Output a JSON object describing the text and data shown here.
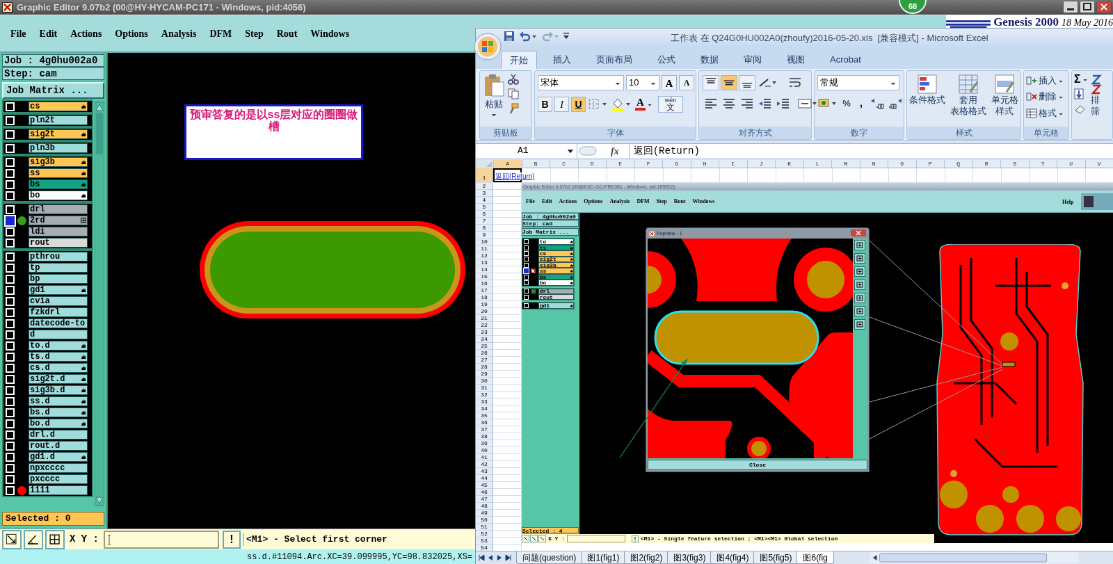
{
  "genesis": {
    "title": "Graphic Editor 9.07b2 (00@HY-HYCAM-PC171 - Windows, pid:4056)",
    "badge": "68",
    "logo_title": "Genesis 2000",
    "logo_date": "18 May 2016",
    "menu": [
      "File",
      "Edit",
      "Actions",
      "Options",
      "Analysis",
      "DFM",
      "Step",
      "Rout",
      "Windows"
    ],
    "job": "Job : 4g0hu002a0",
    "step": "Step: cam",
    "job_matrix": "Job Matrix ...",
    "layer_groups": [
      [
        {
          "name": "cs",
          "color": "#ffc655",
          "kind": "hand",
          "selected": false
        }
      ],
      [
        {
          "name": "pln2t",
          "color": "#a0dcdc",
          "kind": "plain",
          "selected": false
        }
      ],
      [
        {
          "name": "sig2t",
          "color": "#ffc655",
          "kind": "hand",
          "selected": false
        }
      ],
      [
        {
          "name": "pln3b",
          "color": "#a0dcdc",
          "kind": "plain",
          "selected": false
        }
      ],
      [
        {
          "name": "sig3b",
          "color": "#ffc655",
          "kind": "hand",
          "selected": false
        },
        {
          "name": "ss",
          "color": "#ffc655",
          "kind": "hand",
          "selected": false
        },
        {
          "name": "bs",
          "color": "#13a383",
          "kind": "hand",
          "selected": false
        },
        {
          "name": "bo",
          "color": "#ffffff",
          "kind": "hand",
          "selected": false
        }
      ],
      [
        {
          "name": "drl",
          "color": "#a6aeb4",
          "kind": "plain",
          "selected": false
        },
        {
          "name": "2rd",
          "color": "#a6aeb4",
          "kind": "grid",
          "dot": {
            "color": "#3a9a1a"
          },
          "selected": true
        },
        {
          "name": "ldi",
          "color": "#a6aeb4",
          "kind": "plain",
          "selected": false
        },
        {
          "name": "rout",
          "color": "#dadada",
          "kind": "plain",
          "selected": false
        }
      ],
      [
        {
          "name": "pthrou",
          "color": "#a0dcdc",
          "kind": "plain",
          "selected": false
        },
        {
          "name": "tp",
          "color": "#a0dcdc",
          "kind": "plain",
          "selected": false
        },
        {
          "name": "bp",
          "color": "#a0dcdc",
          "kind": "plain",
          "selected": false
        },
        {
          "name": "gd1",
          "color": "#a0dcdc",
          "kind": "hand",
          "selected": false
        },
        {
          "name": "cvia",
          "color": "#a0dcdc",
          "kind": "plain",
          "selected": false
        },
        {
          "name": "fzkdrl",
          "color": "#a0dcdc",
          "kind": "plain",
          "selected": false
        },
        {
          "name": "datecode-to",
          "color": "#a0dcdc",
          "kind": "plain",
          "selected": false
        },
        {
          "name": "d",
          "color": "#a0dcdc",
          "kind": "plain",
          "selected": false
        },
        {
          "name": "to.d",
          "color": "#a0dcdc",
          "kind": "hand",
          "selected": false
        },
        {
          "name": "ts.d",
          "color": "#a0dcdc",
          "kind": "hand",
          "selected": false
        },
        {
          "name": "cs.d",
          "color": "#a0dcdc",
          "kind": "hand",
          "selected": false
        },
        {
          "name": "sig2t.d",
          "color": "#a0dcdc",
          "kind": "hand",
          "selected": false
        },
        {
          "name": "sig3b.d",
          "color": "#a0dcdc",
          "kind": "hand",
          "selected": false
        },
        {
          "name": "ss.d",
          "color": "#a0dcdc",
          "kind": "hand",
          "selected": false
        },
        {
          "name": "bs.d",
          "color": "#a0dcdc",
          "kind": "hand",
          "selected": false
        },
        {
          "name": "bo.d",
          "color": "#a0dcdc",
          "kind": "hand",
          "selected": false
        },
        {
          "name": "drl.d",
          "color": "#a0dcdc",
          "kind": "plain",
          "selected": false
        },
        {
          "name": "rout.d",
          "color": "#a0dcdc",
          "kind": "plain",
          "selected": false
        },
        {
          "name": "gd1.d",
          "color": "#a0dcdc",
          "kind": "hand",
          "selected": false
        },
        {
          "name": "npxcccc",
          "color": "#a0dcdc",
          "kind": "plain",
          "selected": false
        },
        {
          "name": "pxcccc",
          "color": "#a0dcdc",
          "kind": "plain",
          "selected": false
        },
        {
          "name": "1111",
          "color": "#a0dcdc",
          "kind": "plain",
          "dot": {
            "color": "#ff0000"
          },
          "selected": false
        }
      ]
    ],
    "selected_count": "Selected : 0",
    "note": "预审答复的是以ss层对应的圈圈做槽",
    "xy_label": "X Y :",
    "alert_button": "!",
    "prompt": "<M1> - Select first corner",
    "status": "ss.d.#11094.Arc.XC=39.099995,YC=98.832025,XS="
  },
  "excel": {
    "title": "工作表 在 Q24G0HU002A0(zhoufy)2016-05-20.xls  [兼容模式] - Microsoft Excel",
    "tabs": [
      {
        "label": "开始",
        "selected": true
      },
      {
        "label": "插入",
        "selected": false
      },
      {
        "label": "页面布局",
        "selected": false
      },
      {
        "label": "公式",
        "selected": false
      },
      {
        "label": "数据",
        "selected": false
      },
      {
        "label": "审阅",
        "selected": false
      },
      {
        "label": "视图",
        "selected": false
      },
      {
        "label": "Acrobat",
        "selected": false
      }
    ],
    "ribbon": {
      "clipboard": {
        "paste": "粘贴",
        "label": "剪贴板"
      },
      "font": {
        "font_name": "宋体",
        "font_size": "10",
        "grow": "A",
        "shrink": "A",
        "format_buttons": [
          {
            "label": "B",
            "on": false
          },
          {
            "label": "I",
            "on": false
          },
          {
            "label": "U",
            "on": true
          }
        ],
        "font_color": "A",
        "phonetic_top": "wén",
        "phonetic_bottom": "文",
        "label": "字体"
      },
      "alignment": {
        "vertical": [
          {
            "on": false
          },
          {
            "on": true
          },
          {
            "on": false
          }
        ],
        "label": "对齐方式"
      },
      "number": {
        "format": "常规",
        "percent": "%",
        "comma": ",",
        "label": "数字"
      },
      "styles": {
        "items": [
          {
            "lines": [
              "条件格式"
            ]
          },
          {
            "lines": [
              "套用",
              "表格格式"
            ]
          },
          {
            "lines": [
              "单元格",
              "样式"
            ]
          }
        ],
        "label": "样式"
      },
      "cells": {
        "items": [
          "插入",
          "删除",
          "格式"
        ],
        "label": "单元格"
      },
      "editing": {
        "sum": "Σ",
        "sort_cut": "排",
        "filter_cut": "筛"
      }
    },
    "name_box": "A1",
    "fx": "fx",
    "formula": "返回(Return)",
    "columns": [
      "A",
      "B",
      "C",
      "D",
      "E",
      "F",
      "G",
      "H",
      "I",
      "J",
      "K",
      "L",
      "M",
      "N",
      "O",
      "P",
      "Q",
      "R",
      "S",
      "T",
      "U",
      "V"
    ],
    "rows": [
      "1",
      "2",
      "3",
      "4",
      "5",
      "6",
      "7",
      "8",
      "9",
      "10",
      "11",
      "12",
      "13",
      "14",
      "15",
      "16",
      "17",
      "18",
      "19",
      "20",
      "21",
      "22",
      "23",
      "24",
      "25",
      "26",
      "27",
      "28",
      "29",
      "30",
      "31",
      "32",
      "33",
      "34",
      "35",
      "36",
      "37",
      "38",
      "39",
      "40",
      "41",
      "42",
      "43",
      "44",
      "45",
      "46",
      "47",
      "48",
      "49",
      "50",
      "51",
      "52",
      "53",
      "54"
    ],
    "cell_a1": "返回(Return)",
    "sheet_tabs": [
      {
        "label": "问题(question)",
        "selected": false
      },
      {
        "label": "图1(fig1)",
        "selected": false
      },
      {
        "label": "图2(fig2)",
        "selected": false
      },
      {
        "label": "图3(fig3)",
        "selected": false
      },
      {
        "label": "图4(fig4)",
        "selected": false
      },
      {
        "label": "图5(fig5)",
        "selected": false
      },
      {
        "label": "图6(fig",
        "selected": true
      }
    ],
    "embedded_screenshot": {
      "title": "Graphic Editor 9.07b2 (00@KXC-GC-PRE081 - Windows, pid:185552)",
      "menu": [
        "File",
        "Edit",
        "Actions",
        "Options",
        "Analysis",
        "DFM",
        "Step",
        "Rout",
        "Windows"
      ],
      "help": "Help",
      "job": "Job : 4g0hu002a0",
      "step": "Step: cad",
      "job_matrix": "Job Matrix ...",
      "layer_groups": [
        [
          {
            "name": "to",
            "color": "#ffffff",
            "kind": "hand",
            "selected": false
          },
          {
            "name": "ts",
            "color": "#13a383",
            "kind": "hand",
            "selected": false
          },
          {
            "name": "cs",
            "color": "#ffc655",
            "kind": "hand",
            "selected": false
          },
          {
            "name": "sig2t",
            "color": "#ffc655",
            "kind": "hand",
            "selected": false
          },
          {
            "name": "sig3b",
            "color": "#ffc655",
            "kind": "hand",
            "selected": false
          },
          {
            "name": "ss",
            "color": "#ffc655",
            "kind": "hand",
            "cursor": true,
            "selected": true
          },
          {
            "name": "bs",
            "color": "#13a383",
            "kind": "hand",
            "selected": false
          },
          {
            "name": "bo",
            "color": "#ffffff",
            "kind": "hand",
            "selected": false
          }
        ],
        [
          {
            "name": "drl",
            "color": "#a6aeb4",
            "kind": "plain",
            "dot": {
              "color": "#2a8a3a"
            },
            "selected": false
          },
          {
            "name": "rout",
            "color": "#dadada",
            "kind": "plain",
            "selected": false
          }
        ],
        [
          {
            "name": "gd1",
            "color": "#a0dcdc",
            "kind": "hand",
            "selected": false
          }
        ]
      ],
      "popview_title": "Popview - 1",
      "popview_close": "Close",
      "selected_count": "Selected : 4",
      "xy_label": "X Y :",
      "prompt": "<M1> - Single feature selection ; <M1><M1> Global selection"
    }
  }
}
